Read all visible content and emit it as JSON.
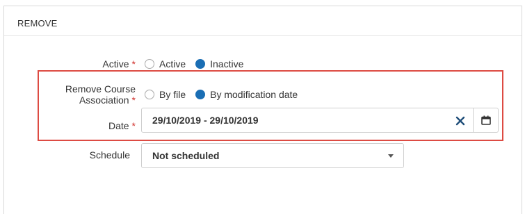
{
  "section": {
    "title": "REMOVE"
  },
  "active_row": {
    "label": "Active",
    "required_mark": "*",
    "options": [
      {
        "label": "Active",
        "checked": false
      },
      {
        "label": "Inactive",
        "checked": true
      }
    ]
  },
  "remove_course_row": {
    "label_line1": "Remove Course",
    "label_line2": "Association",
    "required_mark": "*",
    "options": [
      {
        "label": "By file",
        "checked": false
      },
      {
        "label": "By modification date",
        "checked": true
      }
    ]
  },
  "date_row": {
    "label": "Date",
    "required_mark": "*",
    "value": "29/10/2019 - 29/10/2019",
    "clear_icon": "close-x-icon",
    "calendar_icon": "calendar-icon"
  },
  "schedule_row": {
    "label": "Schedule",
    "value": "Not scheduled",
    "dropdown_icon": "caret-down-icon"
  },
  "colors": {
    "accent": "#1a6eb4",
    "required": "#d0312d",
    "highlight": "#dd4b43"
  }
}
